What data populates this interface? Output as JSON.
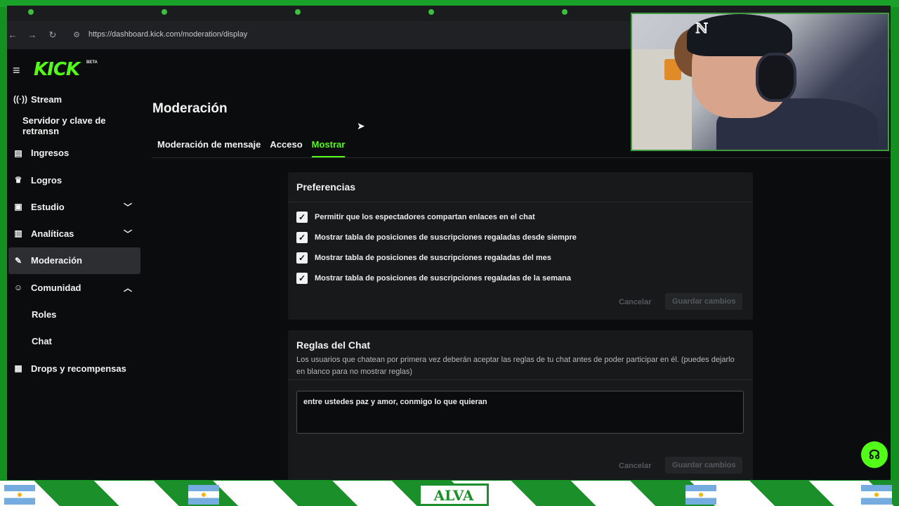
{
  "browser": {
    "url": "https://dashboard.kick.com/moderation/display"
  },
  "brand": {
    "logo": "KICK",
    "badge": "BETA",
    "accent": "#53fc18"
  },
  "sidebar": {
    "items": [
      {
        "label": "Stream",
        "icon": "broadcast-icon"
      },
      {
        "label": "Servidor y clave de retransn"
      },
      {
        "label": "Ingresos",
        "icon": "wallet-icon"
      },
      {
        "label": "Logros",
        "icon": "trophy-icon"
      },
      {
        "label": "Estudio",
        "icon": "studio-icon"
      },
      {
        "label": "Analíticas",
        "icon": "analytics-icon"
      },
      {
        "label": "Moderación",
        "icon": "wrench-icon"
      },
      {
        "label": "Comunidad",
        "icon": "community-icon"
      },
      {
        "label": "Roles"
      },
      {
        "label": "Chat"
      },
      {
        "label": "Drops y recompensas",
        "icon": "gift-icon"
      }
    ]
  },
  "main": {
    "title": "Moderación",
    "tabs": [
      {
        "label": "Moderación de mensaje"
      },
      {
        "label": "Acceso"
      },
      {
        "label": "Mostrar"
      }
    ]
  },
  "preferences": {
    "title": "Preferencias",
    "options": [
      {
        "label": "Permitir que los espectadores compartan enlaces en el chat",
        "checked": true
      },
      {
        "label": "Mostrar tabla de posiciones de suscripciones regaladas desde siempre",
        "checked": true
      },
      {
        "label": "Mostrar tabla de posiciones de suscripciones regaladas del mes",
        "checked": true
      },
      {
        "label": "Mostrar tabla de posiciones de suscripciones regaladas de la semana",
        "checked": true
      }
    ],
    "cancel_label": "Cancelar",
    "save_label": "Guardar cambios"
  },
  "chat_rules": {
    "title": "Reglas del Chat",
    "description": "Los usuarios que chatean por primera vez deberán aceptar las reglas de tu chat antes de poder participar en él. (puedes dejarlo en blanco para no mostrar reglas)",
    "value": "entre ustedes paz y amor, conmigo lo que quieran",
    "cancel_label": "Cancelar",
    "save_label": "Guardar cambios"
  },
  "overlay": {
    "banner_text": "ALVA"
  }
}
